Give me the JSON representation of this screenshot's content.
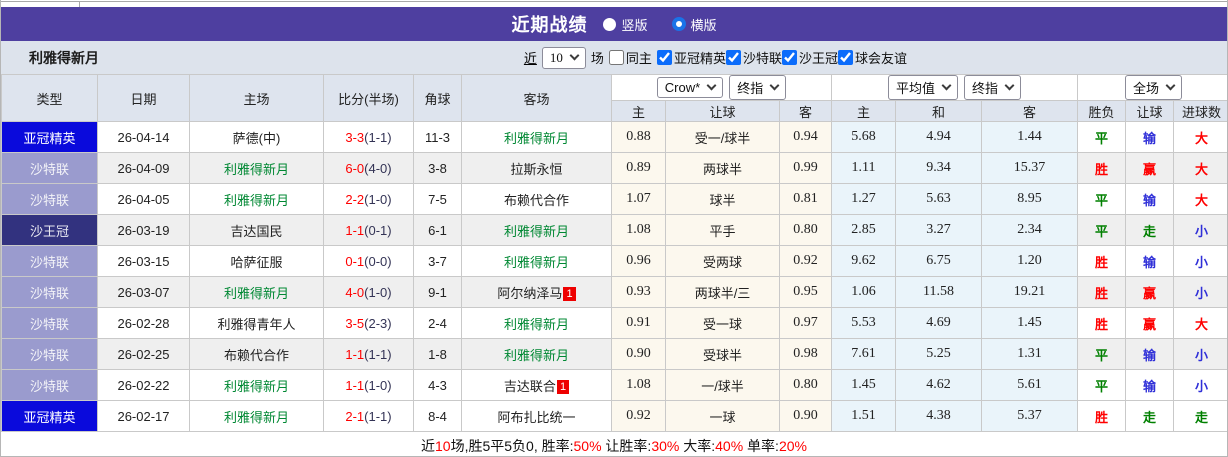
{
  "header": {
    "title": "近期战绩",
    "radio_vertical": "竖版",
    "radio_horizontal": "横版"
  },
  "filter": {
    "team": "利雅得新月",
    "near_label": "近",
    "matches_value": "10",
    "matches_label": "场",
    "same_home_label": "同主",
    "leagues": [
      "亚冠精英",
      "沙特联",
      "沙王冠",
      "球会友谊"
    ]
  },
  "table": {
    "left_headers": [
      "类型",
      "日期",
      "主场",
      "比分(半场)",
      "角球",
      "客场"
    ],
    "controls": {
      "asia_book": "Crow*",
      "asia_stage": "终指",
      "europe_book": "平均值",
      "europe_stage": "终指",
      "scope": "全场"
    },
    "sub_headers": [
      "主",
      "让球",
      "客",
      "主",
      "和",
      "客",
      "胜负",
      "让球",
      "进球数"
    ],
    "rows": [
      {
        "league": "亚冠精英",
        "league_key": "acl",
        "date": "26-04-14",
        "home": "萨德(中)",
        "home_is_hilal": false,
        "score": "3-3",
        "half": "(1-1)",
        "corners": "11-3",
        "away": "利雅得新月",
        "away_is_hilal": true,
        "away_note": "",
        "asia": [
          "0.88",
          "受一/球半",
          "0.94"
        ],
        "europe": [
          "5.68",
          "4.94",
          "1.44"
        ],
        "outcome": {
          "result": "平",
          "result_color": "green",
          "handicap": "输",
          "handicap_color": "blue",
          "goals": "大",
          "goals_color": "red"
        },
        "striped": false
      },
      {
        "league": "沙特联",
        "league_key": "spl",
        "date": "26-04-09",
        "home": "利雅得新月",
        "home_is_hilal": true,
        "score": "6-0",
        "half": "(4-0)",
        "corners": "3-8",
        "away": "拉斯永恒",
        "away_is_hilal": false,
        "away_note": "",
        "asia": [
          "0.89",
          "两球半",
          "0.99"
        ],
        "europe": [
          "1.11",
          "9.34",
          "15.37"
        ],
        "outcome": {
          "result": "胜",
          "result_color": "red",
          "handicap": "赢",
          "handicap_color": "red",
          "goals": "大",
          "goals_color": "red"
        },
        "striped": true
      },
      {
        "league": "沙特联",
        "league_key": "spl",
        "date": "26-04-05",
        "home": "利雅得新月",
        "home_is_hilal": true,
        "score": "2-2",
        "half": "(1-0)",
        "corners": "7-5",
        "away": "布赖代合作",
        "away_is_hilal": false,
        "away_note": "",
        "asia": [
          "1.07",
          "球半",
          "0.81"
        ],
        "europe": [
          "1.27",
          "5.63",
          "8.95"
        ],
        "outcome": {
          "result": "平",
          "result_color": "green",
          "handicap": "输",
          "handicap_color": "blue",
          "goals": "大",
          "goals_color": "red"
        },
        "striped": false
      },
      {
        "league": "沙王冠",
        "league_key": "kc",
        "date": "26-03-19",
        "home": "吉达国民",
        "home_is_hilal": false,
        "score": "1-1",
        "half": "(0-1)",
        "corners": "6-1",
        "away": "利雅得新月",
        "away_is_hilal": true,
        "away_note": "",
        "asia": [
          "1.08",
          "平手",
          "0.80"
        ],
        "europe": [
          "2.85",
          "3.27",
          "2.34"
        ],
        "outcome": {
          "result": "平",
          "result_color": "green",
          "handicap": "走",
          "handicap_color": "green",
          "goals": "小",
          "goals_color": "blue"
        },
        "striped": true
      },
      {
        "league": "沙特联",
        "league_key": "spl",
        "date": "26-03-15",
        "home": "哈萨征服",
        "home_is_hilal": false,
        "score": "0-1",
        "half": "(0-0)",
        "corners": "3-7",
        "away": "利雅得新月",
        "away_is_hilal": true,
        "away_note": "",
        "asia": [
          "0.96",
          "受两球",
          "0.92"
        ],
        "europe": [
          "9.62",
          "6.75",
          "1.20"
        ],
        "outcome": {
          "result": "胜",
          "result_color": "red",
          "handicap": "输",
          "handicap_color": "blue",
          "goals": "小",
          "goals_color": "blue"
        },
        "striped": false
      },
      {
        "league": "沙特联",
        "league_key": "spl",
        "date": "26-03-07",
        "home": "利雅得新月",
        "home_is_hilal": true,
        "score": "4-0",
        "half": "(1-0)",
        "corners": "9-1",
        "away": "阿尔纳泽马",
        "away_is_hilal": false,
        "away_note": "1",
        "asia": [
          "0.93",
          "两球半/三",
          "0.95"
        ],
        "europe": [
          "1.06",
          "11.58",
          "19.21"
        ],
        "outcome": {
          "result": "胜",
          "result_color": "red",
          "handicap": "赢",
          "handicap_color": "red",
          "goals": "小",
          "goals_color": "blue"
        },
        "striped": true
      },
      {
        "league": "沙特联",
        "league_key": "spl",
        "date": "26-02-28",
        "home": "利雅得青年人",
        "home_is_hilal": false,
        "score": "3-5",
        "half": "(2-3)",
        "corners": "2-4",
        "away": "利雅得新月",
        "away_is_hilal": true,
        "away_note": "",
        "asia": [
          "0.91",
          "受一球",
          "0.97"
        ],
        "europe": [
          "5.53",
          "4.69",
          "1.45"
        ],
        "outcome": {
          "result": "胜",
          "result_color": "red",
          "handicap": "赢",
          "handicap_color": "red",
          "goals": "大",
          "goals_color": "red"
        },
        "striped": false
      },
      {
        "league": "沙特联",
        "league_key": "spl",
        "date": "26-02-25",
        "home": "布赖代合作",
        "home_is_hilal": false,
        "score": "1-1",
        "half": "(1-1)",
        "corners": "1-8",
        "away": "利雅得新月",
        "away_is_hilal": true,
        "away_note": "",
        "asia": [
          "0.90",
          "受球半",
          "0.98"
        ],
        "europe": [
          "7.61",
          "5.25",
          "1.31"
        ],
        "outcome": {
          "result": "平",
          "result_color": "green",
          "handicap": "输",
          "handicap_color": "blue",
          "goals": "小",
          "goals_color": "blue"
        },
        "striped": true
      },
      {
        "league": "沙特联",
        "league_key": "spl",
        "date": "26-02-22",
        "home": "利雅得新月",
        "home_is_hilal": true,
        "score": "1-1",
        "half": "(1-0)",
        "corners": "4-3",
        "away": "吉达联合",
        "away_is_hilal": false,
        "away_note": "1",
        "asia": [
          "1.08",
          "一/球半",
          "0.80"
        ],
        "europe": [
          "1.45",
          "4.62",
          "5.61"
        ],
        "outcome": {
          "result": "平",
          "result_color": "green",
          "handicap": "输",
          "handicap_color": "blue",
          "goals": "小",
          "goals_color": "blue"
        },
        "striped": false
      },
      {
        "league": "亚冠精英",
        "league_key": "acl",
        "date": "26-02-17",
        "home": "利雅得新月",
        "home_is_hilal": true,
        "score": "2-1",
        "half": "(1-1)",
        "corners": "8-4",
        "away": "阿布扎比统一",
        "away_is_hilal": false,
        "away_note": "",
        "asia": [
          "0.92",
          "一球",
          "0.90"
        ],
        "europe": [
          "1.51",
          "4.38",
          "5.37"
        ],
        "outcome": {
          "result": "胜",
          "result_color": "red",
          "handicap": "走",
          "handicap_color": "green",
          "goals": "走",
          "goals_color": "green"
        },
        "striped": false
      }
    ]
  },
  "footer": {
    "segments": [
      {
        "t": "近",
        "c": "k"
      },
      {
        "t": "10",
        "c": "r"
      },
      {
        "t": "场,胜5平5负0, 胜率:",
        "c": "k"
      },
      {
        "t": "50%",
        "c": "r"
      },
      {
        "t": " 让胜率:",
        "c": "k"
      },
      {
        "t": "30%",
        "c": "r"
      },
      {
        "t": " 大率:",
        "c": "k"
      },
      {
        "t": "40%",
        "c": "r"
      },
      {
        "t": " 单率:",
        "c": "k"
      },
      {
        "t": "20%",
        "c": "r"
      }
    ]
  },
  "colors": {
    "title_bar": "#4e3fa0",
    "league_acl": "#0a0adc",
    "league_spl": "#9a9bce",
    "league_kingcup": "#32327f",
    "hilal_green": "#008833",
    "score_red": "#ff0000",
    "result_red": "#ff0000",
    "result_green": "#008000",
    "result_blue": "#3030d8",
    "asia_col_bg": "#fcf8ee",
    "europe_col_bg": "#eaf4fa"
  }
}
